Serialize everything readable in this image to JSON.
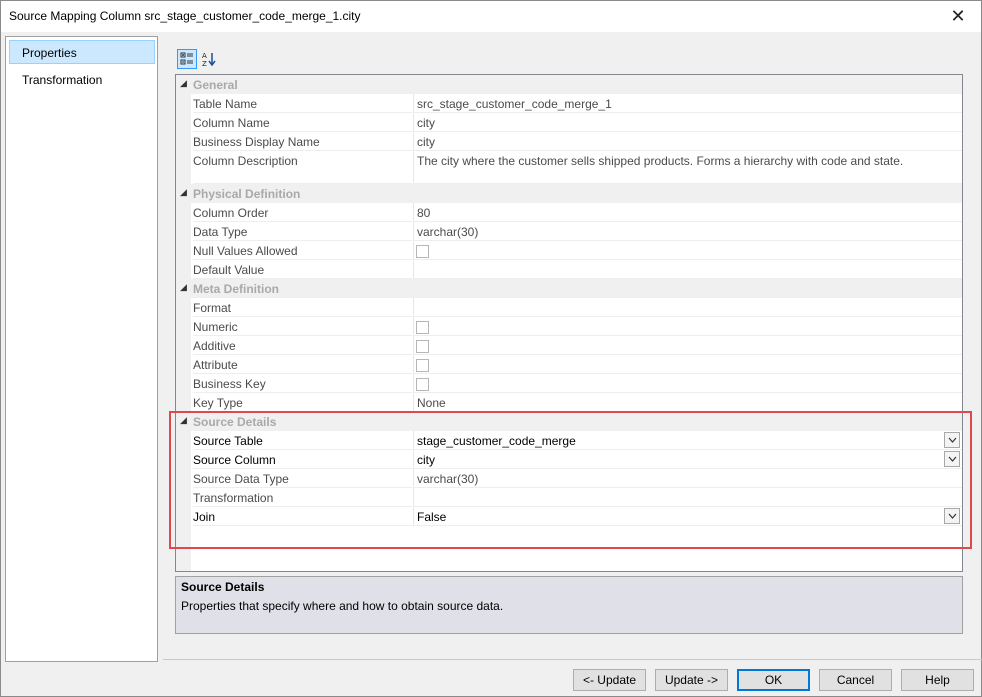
{
  "window": {
    "title": "Source Mapping Column src_stage_customer_code_merge_1.city",
    "close_glyph": "✕"
  },
  "nav": {
    "items": [
      {
        "label": "Properties",
        "selected": true
      },
      {
        "label": "Transformation",
        "selected": false
      }
    ]
  },
  "toolbar": {
    "categorized_icon": "categorized-icon",
    "alphabetical_icon": "sort-az-icon"
  },
  "grid": {
    "categories": {
      "general": "General",
      "physical": "Physical Definition",
      "meta": "Meta Definition",
      "source": "Source Details"
    },
    "general": {
      "table_name": {
        "name": "Table Name",
        "value": "src_stage_customer_code_merge_1"
      },
      "column_name": {
        "name": "Column Name",
        "value": "city"
      },
      "business_display_name": {
        "name": "Business Display Name",
        "value": "city"
      },
      "column_description": {
        "name": "Column Description",
        "value": "The city where the customer sells shipped products.  Forms a hierarchy with code and state."
      }
    },
    "physical": {
      "column_order": {
        "name": "Column Order",
        "value": "80"
      },
      "data_type": {
        "name": "Data Type",
        "value": "varchar(30)"
      },
      "null_values_allowed": {
        "name": "Null Values Allowed",
        "checked": false
      },
      "default_value": {
        "name": "Default Value",
        "value": ""
      }
    },
    "meta": {
      "format": {
        "name": "Format",
        "value": ""
      },
      "numeric": {
        "name": "Numeric",
        "checked": false
      },
      "additive": {
        "name": "Additive",
        "checked": false
      },
      "attribute": {
        "name": "Attribute",
        "checked": false
      },
      "business_key": {
        "name": "Business Key",
        "checked": false
      },
      "key_type": {
        "name": "Key Type",
        "value": "None"
      }
    },
    "source": {
      "source_table": {
        "name": "Source Table",
        "value": "stage_customer_code_merge"
      },
      "source_column": {
        "name": "Source Column",
        "value": "city"
      },
      "source_data_type": {
        "name": "Source Data Type",
        "value": "varchar(30)"
      },
      "transformation": {
        "name": "Transformation",
        "value": ""
      },
      "join": {
        "name": "Join",
        "value": "False"
      }
    }
  },
  "description": {
    "title": "Source Details",
    "text": "Properties that specify where and how to obtain source data."
  },
  "buttons": {
    "update_prev": "<- Update",
    "update_next": "Update ->",
    "ok": "OK",
    "cancel": "Cancel",
    "help": "Help"
  },
  "colors": {
    "highlight_border": "#e0484d",
    "nav_selected": "#cce8ff"
  }
}
